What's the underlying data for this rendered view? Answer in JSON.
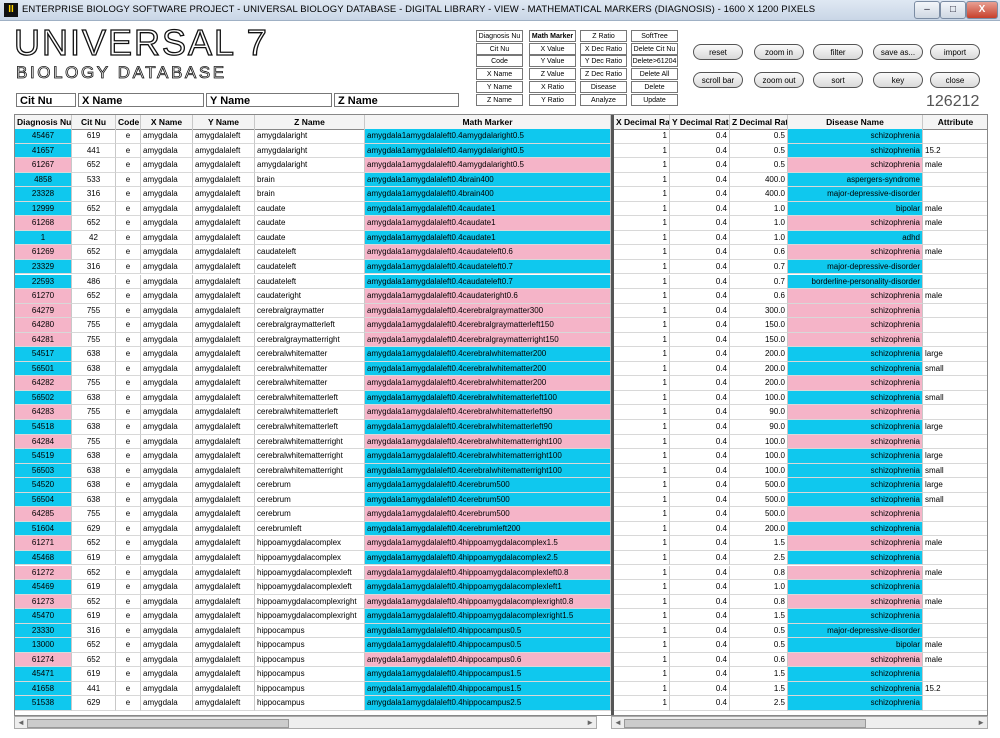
{
  "window": {
    "title": "ENTERPRISE BIOLOGY SOFTWARE PROJECT  -  UNIVERSAL BIOLOGY DATABASE  -  DIGITAL LIBRARY  -  VIEW  -  MATHEMATICAL MARKERS (DIAGNOSIS)  -  1600 X 1200 PIXELS",
    "icon_text": "II",
    "min": "–",
    "max": "□",
    "close": "X"
  },
  "logo": {
    "line1": "UNIVERSAL 7",
    "line2": "BIOLOGY DATABASE"
  },
  "fields": {
    "cit": "Cit Nu",
    "x": "X Name",
    "y": "Y Name",
    "z": "Z Name"
  },
  "record_count": "126212",
  "buttons": {
    "col1": [
      "Diagnosis Nu",
      "Cit Nu",
      "Code",
      "X Name",
      "Y Name",
      "Z Name"
    ],
    "col2": [
      "Math Marker",
      "X Value",
      "Y Value",
      "Z Value",
      "X Ratio",
      "Y Ratio"
    ],
    "col3": [
      "Z Ratio",
      "X Dec Ratio",
      "Y Dec Ratio",
      "Z Dec Ratio",
      "Disease",
      "Analyze"
    ],
    "col4": [
      "SoftTree",
      "Delete Cit Nu",
      "Delete>61204",
      "Delete All",
      "Delete",
      "Update"
    ],
    "pills_row1": [
      "reset",
      "zoom in",
      "filter",
      "save as...",
      "import"
    ],
    "pills_row2": [
      "scroll bar",
      "zoom out",
      "sort",
      "key",
      "close"
    ]
  },
  "grid": {
    "headers": [
      "Diagnosis Nu",
      "Cit Nu",
      "Code",
      "X Name",
      "Y Name",
      "Z Name",
      "Math Marker",
      "X Decimal Ratio",
      "Y Decimal Ratio",
      "Z Decimal Ratio",
      "Disease Name",
      "Attribute"
    ],
    "colors": {
      "cyan": "#0fc8ee",
      "pink": "#f5b4c8"
    },
    "rows": [
      {
        "d": "45467",
        "c": "619",
        "code": "e",
        "x": "amygdala",
        "y": "amygdalaleft",
        "z": "amygdalaright",
        "m": "amygdala1amygdalaleft0.4amygdalaright0.5",
        "xd": "1",
        "yd": "0.4",
        "zd": "0.5",
        "dis": "schizophrenia",
        "attr": "",
        "color": "cyan"
      },
      {
        "d": "41657",
        "c": "441",
        "code": "e",
        "x": "amygdala",
        "y": "amygdalaleft",
        "z": "amygdalaright",
        "m": "amygdala1amygdalaleft0.4amygdalaright0.5",
        "xd": "1",
        "yd": "0.4",
        "zd": "0.5",
        "dis": "schizophrenia",
        "attr": "15.2",
        "color": "cyan"
      },
      {
        "d": "61267",
        "c": "652",
        "code": "e",
        "x": "amygdala",
        "y": "amygdalaleft",
        "z": "amygdalaright",
        "m": "amygdala1amygdalaleft0.4amygdalaright0.5",
        "xd": "1",
        "yd": "0.4",
        "zd": "0.5",
        "dis": "schizophrenia",
        "attr": "male",
        "color": "pink"
      },
      {
        "d": "4858",
        "c": "533",
        "code": "e",
        "x": "amygdala",
        "y": "amygdalaleft",
        "z": "brain",
        "m": "amygdala1amygdalaleft0.4brain400",
        "xd": "1",
        "yd": "0.4",
        "zd": "400.0",
        "dis": "aspergers-syndrome",
        "attr": "",
        "color": "cyan"
      },
      {
        "d": "23328",
        "c": "316",
        "code": "e",
        "x": "amygdala",
        "y": "amygdalaleft",
        "z": "brain",
        "m": "amygdala1amygdalaleft0.4brain400",
        "xd": "1",
        "yd": "0.4",
        "zd": "400.0",
        "dis": "major-depressive-disorder",
        "attr": "",
        "color": "cyan"
      },
      {
        "d": "12999",
        "c": "652",
        "code": "e",
        "x": "amygdala",
        "y": "amygdalaleft",
        "z": "caudate",
        "m": "amygdala1amygdalaleft0.4caudate1",
        "xd": "1",
        "yd": "0.4",
        "zd": "1.0",
        "dis": "bipolar",
        "attr": "male",
        "color": "cyan"
      },
      {
        "d": "61268",
        "c": "652",
        "code": "e",
        "x": "amygdala",
        "y": "amygdalaleft",
        "z": "caudate",
        "m": "amygdala1amygdalaleft0.4caudate1",
        "xd": "1",
        "yd": "0.4",
        "zd": "1.0",
        "dis": "schizophrenia",
        "attr": "male",
        "color": "pink"
      },
      {
        "d": "1",
        "c": "42",
        "code": "e",
        "x": "amygdala",
        "y": "amygdalaleft",
        "z": "caudate",
        "m": "amygdala1amygdalaleft0.4caudate1",
        "xd": "1",
        "yd": "0.4",
        "zd": "1.0",
        "dis": "adhd",
        "attr": "",
        "color": "cyan"
      },
      {
        "d": "61269",
        "c": "652",
        "code": "e",
        "x": "amygdala",
        "y": "amygdalaleft",
        "z": "caudateleft",
        "m": "amygdala1amygdalaleft0.4caudateleft0.6",
        "xd": "1",
        "yd": "0.4",
        "zd": "0.6",
        "dis": "schizophrenia",
        "attr": "male",
        "color": "pink"
      },
      {
        "d": "23329",
        "c": "316",
        "code": "e",
        "x": "amygdala",
        "y": "amygdalaleft",
        "z": "caudateleft",
        "m": "amygdala1amygdalaleft0.4caudateleft0.7",
        "xd": "1",
        "yd": "0.4",
        "zd": "0.7",
        "dis": "major-depressive-disorder",
        "attr": "",
        "color": "cyan"
      },
      {
        "d": "22593",
        "c": "486",
        "code": "e",
        "x": "amygdala",
        "y": "amygdalaleft",
        "z": "caudateleft",
        "m": "amygdala1amygdalaleft0.4caudateleft0.7",
        "xd": "1",
        "yd": "0.4",
        "zd": "0.7",
        "dis": "borderline-personality-disorder",
        "attr": "",
        "color": "cyan"
      },
      {
        "d": "61270",
        "c": "652",
        "code": "e",
        "x": "amygdala",
        "y": "amygdalaleft",
        "z": "caudateright",
        "m": "amygdala1amygdalaleft0.4caudateright0.6",
        "xd": "1",
        "yd": "0.4",
        "zd": "0.6",
        "dis": "schizophrenia",
        "attr": "male",
        "color": "pink"
      },
      {
        "d": "64279",
        "c": "755",
        "code": "e",
        "x": "amygdala",
        "y": "amygdalaleft",
        "z": "cerebralgraymatter",
        "m": "amygdala1amygdalaleft0.4cerebralgraymatter300",
        "xd": "1",
        "yd": "0.4",
        "zd": "300.0",
        "dis": "schizophrenia",
        "attr": "",
        "color": "pink"
      },
      {
        "d": "64280",
        "c": "755",
        "code": "e",
        "x": "amygdala",
        "y": "amygdalaleft",
        "z": "cerebralgraymatterleft",
        "m": "amygdala1amygdalaleft0.4cerebralgraymatterleft150",
        "xd": "1",
        "yd": "0.4",
        "zd": "150.0",
        "dis": "schizophrenia",
        "attr": "",
        "color": "pink"
      },
      {
        "d": "64281",
        "c": "755",
        "code": "e",
        "x": "amygdala",
        "y": "amygdalaleft",
        "z": "cerebralgraymatterright",
        "m": "amygdala1amygdalaleft0.4cerebralgraymatterright150",
        "xd": "1",
        "yd": "0.4",
        "zd": "150.0",
        "dis": "schizophrenia",
        "attr": "",
        "color": "pink"
      },
      {
        "d": "54517",
        "c": "638",
        "code": "e",
        "x": "amygdala",
        "y": "amygdalaleft",
        "z": "cerebralwhitematter",
        "m": "amygdala1amygdalaleft0.4cerebralwhitematter200",
        "xd": "1",
        "yd": "0.4",
        "zd": "200.0",
        "dis": "schizophrenia",
        "attr": "large",
        "color": "cyan"
      },
      {
        "d": "56501",
        "c": "638",
        "code": "e",
        "x": "amygdala",
        "y": "amygdalaleft",
        "z": "cerebralwhitematter",
        "m": "amygdala1amygdalaleft0.4cerebralwhitematter200",
        "xd": "1",
        "yd": "0.4",
        "zd": "200.0",
        "dis": "schizophrenia",
        "attr": "small",
        "color": "cyan"
      },
      {
        "d": "64282",
        "c": "755",
        "code": "e",
        "x": "amygdala",
        "y": "amygdalaleft",
        "z": "cerebralwhitematter",
        "m": "amygdala1amygdalaleft0.4cerebralwhitematter200",
        "xd": "1",
        "yd": "0.4",
        "zd": "200.0",
        "dis": "schizophrenia",
        "attr": "",
        "color": "pink"
      },
      {
        "d": "56502",
        "c": "638",
        "code": "e",
        "x": "amygdala",
        "y": "amygdalaleft",
        "z": "cerebralwhitematterleft",
        "m": "amygdala1amygdalaleft0.4cerebralwhitematterleft100",
        "xd": "1",
        "yd": "0.4",
        "zd": "100.0",
        "dis": "schizophrenia",
        "attr": "small",
        "color": "cyan"
      },
      {
        "d": "64283",
        "c": "755",
        "code": "e",
        "x": "amygdala",
        "y": "amygdalaleft",
        "z": "cerebralwhitematterleft",
        "m": "amygdala1amygdalaleft0.4cerebralwhitematterleft90",
        "xd": "1",
        "yd": "0.4",
        "zd": "90.0",
        "dis": "schizophrenia",
        "attr": "",
        "color": "pink"
      },
      {
        "d": "54518",
        "c": "638",
        "code": "e",
        "x": "amygdala",
        "y": "amygdalaleft",
        "z": "cerebralwhitematterleft",
        "m": "amygdala1amygdalaleft0.4cerebralwhitematterleft90",
        "xd": "1",
        "yd": "0.4",
        "zd": "90.0",
        "dis": "schizophrenia",
        "attr": "large",
        "color": "cyan"
      },
      {
        "d": "64284",
        "c": "755",
        "code": "e",
        "x": "amygdala",
        "y": "amygdalaleft",
        "z": "cerebralwhitematterright",
        "m": "amygdala1amygdalaleft0.4cerebralwhitematterright100",
        "xd": "1",
        "yd": "0.4",
        "zd": "100.0",
        "dis": "schizophrenia",
        "attr": "",
        "color": "pink"
      },
      {
        "d": "54519",
        "c": "638",
        "code": "e",
        "x": "amygdala",
        "y": "amygdalaleft",
        "z": "cerebralwhitematterright",
        "m": "amygdala1amygdalaleft0.4cerebralwhitematterright100",
        "xd": "1",
        "yd": "0.4",
        "zd": "100.0",
        "dis": "schizophrenia",
        "attr": "large",
        "color": "cyan"
      },
      {
        "d": "56503",
        "c": "638",
        "code": "e",
        "x": "amygdala",
        "y": "amygdalaleft",
        "z": "cerebralwhitematterright",
        "m": "amygdala1amygdalaleft0.4cerebralwhitematterright100",
        "xd": "1",
        "yd": "0.4",
        "zd": "100.0",
        "dis": "schizophrenia",
        "attr": "small",
        "color": "cyan"
      },
      {
        "d": "54520",
        "c": "638",
        "code": "e",
        "x": "amygdala",
        "y": "amygdalaleft",
        "z": "cerebrum",
        "m": "amygdala1amygdalaleft0.4cerebrum500",
        "xd": "1",
        "yd": "0.4",
        "zd": "500.0",
        "dis": "schizophrenia",
        "attr": "large",
        "color": "cyan"
      },
      {
        "d": "56504",
        "c": "638",
        "code": "e",
        "x": "amygdala",
        "y": "amygdalaleft",
        "z": "cerebrum",
        "m": "amygdala1amygdalaleft0.4cerebrum500",
        "xd": "1",
        "yd": "0.4",
        "zd": "500.0",
        "dis": "schizophrenia",
        "attr": "small",
        "color": "cyan"
      },
      {
        "d": "64285",
        "c": "755",
        "code": "e",
        "x": "amygdala",
        "y": "amygdalaleft",
        "z": "cerebrum",
        "m": "amygdala1amygdalaleft0.4cerebrum500",
        "xd": "1",
        "yd": "0.4",
        "zd": "500.0",
        "dis": "schizophrenia",
        "attr": "",
        "color": "pink"
      },
      {
        "d": "51604",
        "c": "629",
        "code": "e",
        "x": "amygdala",
        "y": "amygdalaleft",
        "z": "cerebrumleft",
        "m": "amygdala1amygdalaleft0.4cerebrumleft200",
        "xd": "1",
        "yd": "0.4",
        "zd": "200.0",
        "dis": "schizophrenia",
        "attr": "",
        "color": "cyan"
      },
      {
        "d": "61271",
        "c": "652",
        "code": "e",
        "x": "amygdala",
        "y": "amygdalaleft",
        "z": "hippoamygdalacomplex",
        "m": "amygdala1amygdalaleft0.4hippoamygdalacomplex1.5",
        "xd": "1",
        "yd": "0.4",
        "zd": "1.5",
        "dis": "schizophrenia",
        "attr": "male",
        "color": "pink"
      },
      {
        "d": "45468",
        "c": "619",
        "code": "e",
        "x": "amygdala",
        "y": "amygdalaleft",
        "z": "hippoamygdalacomplex",
        "m": "amygdala1amygdalaleft0.4hippoamygdalacomplex2.5",
        "xd": "1",
        "yd": "0.4",
        "zd": "2.5",
        "dis": "schizophrenia",
        "attr": "",
        "color": "cyan"
      },
      {
        "d": "61272",
        "c": "652",
        "code": "e",
        "x": "amygdala",
        "y": "amygdalaleft",
        "z": "hippoamygdalacomplexleft",
        "m": "amygdala1amygdalaleft0.4hippoamygdalacomplexleft0.8",
        "xd": "1",
        "yd": "0.4",
        "zd": "0.8",
        "dis": "schizophrenia",
        "attr": "male",
        "color": "pink"
      },
      {
        "d": "45469",
        "c": "619",
        "code": "e",
        "x": "amygdala",
        "y": "amygdalaleft",
        "z": "hippoamygdalacomplexleft",
        "m": "amygdala1amygdalaleft0.4hippoamygdalacomplexleft1",
        "xd": "1",
        "yd": "0.4",
        "zd": "1.0",
        "dis": "schizophrenia",
        "attr": "",
        "color": "cyan"
      },
      {
        "d": "61273",
        "c": "652",
        "code": "e",
        "x": "amygdala",
        "y": "amygdalaleft",
        "z": "hippoamygdalacomplexright",
        "m": "amygdala1amygdalaleft0.4hippoamygdalacomplexright0.8",
        "xd": "1",
        "yd": "0.4",
        "zd": "0.8",
        "dis": "schizophrenia",
        "attr": "male",
        "color": "pink"
      },
      {
        "d": "45470",
        "c": "619",
        "code": "e",
        "x": "amygdala",
        "y": "amygdalaleft",
        "z": "hippoamygdalacomplexright",
        "m": "amygdala1amygdalaleft0.4hippoamygdalacomplexright1.5",
        "xd": "1",
        "yd": "0.4",
        "zd": "1.5",
        "dis": "schizophrenia",
        "attr": "",
        "color": "cyan"
      },
      {
        "d": "23330",
        "c": "316",
        "code": "e",
        "x": "amygdala",
        "y": "amygdalaleft",
        "z": "hippocampus",
        "m": "amygdala1amygdalaleft0.4hippocampus0.5",
        "xd": "1",
        "yd": "0.4",
        "zd": "0.5",
        "dis": "major-depressive-disorder",
        "attr": "",
        "color": "cyan"
      },
      {
        "d": "13000",
        "c": "652",
        "code": "e",
        "x": "amygdala",
        "y": "amygdalaleft",
        "z": "hippocampus",
        "m": "amygdala1amygdalaleft0.4hippocampus0.5",
        "xd": "1",
        "yd": "0.4",
        "zd": "0.5",
        "dis": "bipolar",
        "attr": "male",
        "color": "cyan"
      },
      {
        "d": "61274",
        "c": "652",
        "code": "e",
        "x": "amygdala",
        "y": "amygdalaleft",
        "z": "hippocampus",
        "m": "amygdala1amygdalaleft0.4hippocampus0.6",
        "xd": "1",
        "yd": "0.4",
        "zd": "0.6",
        "dis": "schizophrenia",
        "attr": "male",
        "color": "pink"
      },
      {
        "d": "45471",
        "c": "619",
        "code": "e",
        "x": "amygdala",
        "y": "amygdalaleft",
        "z": "hippocampus",
        "m": "amygdala1amygdalaleft0.4hippocampus1.5",
        "xd": "1",
        "yd": "0.4",
        "zd": "1.5",
        "dis": "schizophrenia",
        "attr": "",
        "color": "cyan"
      },
      {
        "d": "41658",
        "c": "441",
        "code": "e",
        "x": "amygdala",
        "y": "amygdalaleft",
        "z": "hippocampus",
        "m": "amygdala1amygdalaleft0.4hippocampus1.5",
        "xd": "1",
        "yd": "0.4",
        "zd": "1.5",
        "dis": "schizophrenia",
        "attr": "15.2",
        "color": "cyan"
      },
      {
        "d": "51538",
        "c": "629",
        "code": "e",
        "x": "amygdala",
        "y": "amygdalaleft",
        "z": "hippocampus",
        "m": "amygdala1amygdalaleft0.4hippocampus2.5",
        "xd": "1",
        "yd": "0.4",
        "zd": "2.5",
        "dis": "schizophrenia",
        "attr": "",
        "color": "cyan"
      }
    ]
  },
  "scroll": {
    "left_arrow": "◄",
    "right_arrow": "►"
  }
}
